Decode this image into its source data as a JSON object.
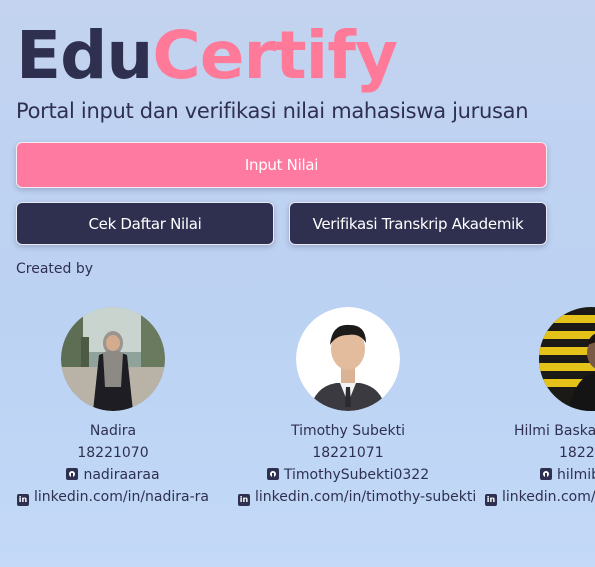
{
  "header": {
    "title_part_1": "Edu",
    "title_part_2": "Certify",
    "subtitle": "Portal input dan verifikasi nilai mahasiswa jurusan"
  },
  "actions": {
    "input_nilai": "Input Nilai",
    "cek_daftar_nilai": "Cek Daftar Nilai",
    "verifikasi_transkrip": "Verifikasi Transkrip Akademik"
  },
  "credits": {
    "label": "Created by",
    "people": [
      {
        "name": "Nadira",
        "nim": "18221070",
        "github": "nadiraaraa",
        "linkedin": "linkedin.com/in/nadira-ra"
      },
      {
        "name": "Timothy Subekti",
        "nim": "18221071",
        "github": "TimothySubekti0322",
        "linkedin": "linkedin.com/in/timothy-subekti"
      },
      {
        "name": "Hilmi Baska",
        "nim": "1822",
        "github": "hilmib",
        "linkedin": "linkedin.com/"
      }
    ]
  },
  "colors": {
    "primary_dark": "#2f3050",
    "accent_pink": "#ff7a98",
    "background": "#c0d5f2"
  },
  "icons": {
    "github": "github-icon",
    "linkedin": "linkedin-icon"
  }
}
